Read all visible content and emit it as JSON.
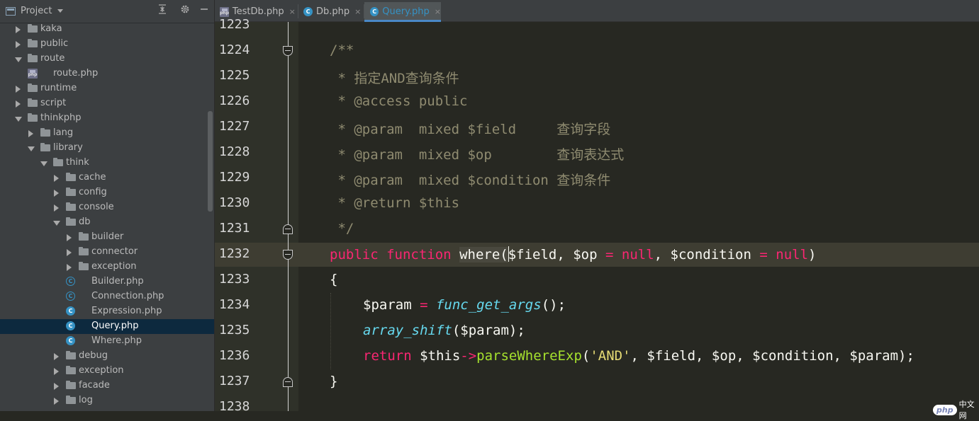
{
  "project_panel": {
    "title": "Project",
    "tree": [
      {
        "label": "kaka",
        "type": "folder",
        "state": "collapsed"
      },
      {
        "label": "public",
        "type": "folder",
        "state": "collapsed"
      },
      {
        "label": "route",
        "type": "folder",
        "state": "expanded"
      },
      {
        "label": "route.php",
        "type": "php-file"
      },
      {
        "label": "runtime",
        "type": "folder",
        "state": "collapsed"
      },
      {
        "label": "script",
        "type": "folder",
        "state": "collapsed"
      },
      {
        "label": "thinkphp",
        "type": "folder",
        "state": "expanded"
      },
      {
        "label": "lang",
        "type": "folder",
        "state": "collapsed"
      },
      {
        "label": "library",
        "type": "folder",
        "state": "expanded"
      },
      {
        "label": "think",
        "type": "folder",
        "state": "expanded"
      },
      {
        "label": "cache",
        "type": "folder",
        "state": "collapsed"
      },
      {
        "label": "config",
        "type": "folder",
        "state": "collapsed"
      },
      {
        "label": "console",
        "type": "folder",
        "state": "collapsed"
      },
      {
        "label": "db",
        "type": "folder",
        "state": "expanded"
      },
      {
        "label": "builder",
        "type": "folder",
        "state": "collapsed"
      },
      {
        "label": "connector",
        "type": "folder",
        "state": "collapsed"
      },
      {
        "label": "exception",
        "type": "folder",
        "state": "collapsed"
      },
      {
        "label": "Builder.php",
        "type": "abstract-class-file"
      },
      {
        "label": "Connection.php",
        "type": "abstract-class-file"
      },
      {
        "label": "Expression.php",
        "type": "class-file"
      },
      {
        "label": "Query.php",
        "type": "class-file",
        "selected": true
      },
      {
        "label": "Where.php",
        "type": "class-file"
      },
      {
        "label": "debug",
        "type": "folder",
        "state": "collapsed"
      },
      {
        "label": "exception",
        "type": "folder",
        "state": "collapsed"
      },
      {
        "label": "facade",
        "type": "folder",
        "state": "collapsed"
      },
      {
        "label": "log",
        "type": "folder",
        "state": "collapsed"
      }
    ]
  },
  "tabs": [
    {
      "label": "TestDb.php",
      "icon": "php-file-icon",
      "active": false
    },
    {
      "label": "Db.php",
      "icon": "class-icon",
      "active": false
    },
    {
      "label": "Query.php",
      "icon": "class-icon",
      "active": true
    }
  ],
  "tab_close_glyph": "×",
  "class_icon_letter": "C",
  "php_icon_text": "php",
  "editor": {
    "current_line": "1232",
    "line_numbers": [
      "1223",
      "1224",
      "1225",
      "1226",
      "1227",
      "1228",
      "1229",
      "1230",
      "1231",
      "1232",
      "1233",
      "1234",
      "1235",
      "1236",
      "1237",
      "1238"
    ],
    "code": {
      "l1224": "/**",
      "l1225": " * 指定AND查询条件",
      "l1226": " * @access public",
      "l1227": " * @param  mixed $field     查询字段",
      "l1228": " * @param  mixed $op        查询表达式",
      "l1229": " * @param  mixed $condition 查询条件",
      "l1230": " * @return $this",
      "l1231": " */",
      "l1232": {
        "kw_public": "public",
        "kw_function": "function",
        "fn_name": "where",
        "open": "(",
        "p1": "$field, $op ",
        "eq1": "=",
        "null1": " null",
        "p2": ", $condition ",
        "eq2": "=",
        "null2": " null",
        "close": ")"
      },
      "l1233": "{",
      "l1234": {
        "var": "$param ",
        "eq": "=",
        "fn": " func_get_args",
        "rest": "();"
      },
      "l1235": {
        "fn": "array_shift",
        "rest": "($param);"
      },
      "l1236": {
        "kw": "return",
        "this": " $this",
        "arrow": "->",
        "method": "parseWhereExp",
        "open": "(",
        "str": "'AND'",
        "rest": ", $field, $op, $condition, $param);"
      },
      "l1237": "}"
    }
  },
  "watermark": {
    "logo": "php",
    "text": "中文网"
  },
  "colors": {
    "keyword": "#f92672",
    "builtin": "#66d9ef",
    "method": "#a6e22e",
    "string": "#e6db74",
    "comment": "#8f8b70",
    "selection": "#0d293e",
    "accent": "#3592c4"
  }
}
